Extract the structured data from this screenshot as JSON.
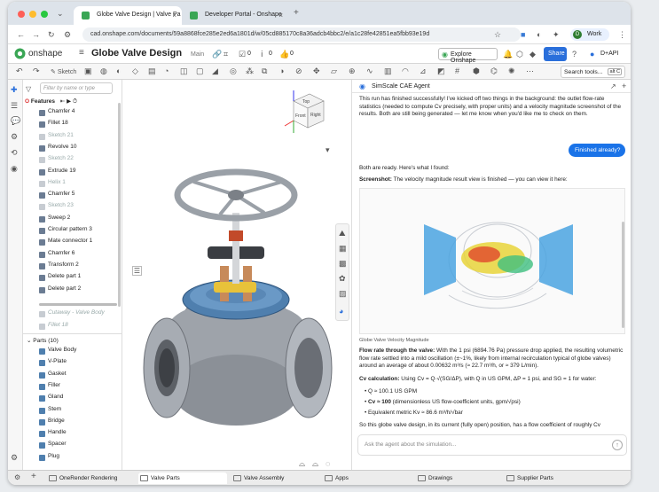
{
  "browser": {
    "tabs": [
      {
        "label": "Globe Valve Design | Valve Pa"
      },
      {
        "label": "Developer Portal - Onshape"
      }
    ],
    "url": "cad.onshape.com/documents/59a8868fce285e2ed6a1801d/w/05cd885170c8a36adcb4bbc2/e/a1c28fe42851ea5fbb93e19d",
    "profile_label": "Work"
  },
  "app": {
    "logo": "onshape",
    "doc_title": "Globe Valve Design",
    "branch": "Main",
    "counts": {
      "a": "0",
      "b": "0",
      "c": "0"
    },
    "explore_label": "Explore Onshape",
    "share_label": "Share",
    "user_label": "D+API",
    "search_label": "Search tools...",
    "search_hint": "alt C",
    "sketch_label": "Sketch"
  },
  "tree": {
    "filter_placeholder": "Filter by name or type",
    "features_label": "Features",
    "items": [
      {
        "label": "Chamfer 4",
        "dim": false
      },
      {
        "label": "Fillet 18",
        "dim": false
      },
      {
        "label": "Sketch 21",
        "dim": true
      },
      {
        "label": "Revolve 10",
        "dim": false
      },
      {
        "label": "Sketch 22",
        "dim": true
      },
      {
        "label": "Extrude 19",
        "dim": false
      },
      {
        "label": "Helix 1",
        "dim": true
      },
      {
        "label": "Chamfer 5",
        "dim": false
      },
      {
        "label": "Sketch 23",
        "dim": true
      },
      {
        "label": "Sweep 2",
        "dim": false
      },
      {
        "label": "Circular pattern 3",
        "dim": false
      },
      {
        "label": "Mate connector 1",
        "dim": false
      },
      {
        "label": "Chamfer 6",
        "dim": false
      },
      {
        "label": "Transform 2",
        "dim": false
      },
      {
        "label": "Delete part 1",
        "dim": false
      },
      {
        "label": "Delete part 2",
        "dim": false
      }
    ],
    "rollback": [
      {
        "label": "Cutaway - Valve Body"
      },
      {
        "label": "Fillet 18"
      }
    ],
    "parts_label": "Parts (10)",
    "parts": [
      "Valve Body",
      "V-Plate",
      "Gasket",
      "Filler",
      "Gland",
      "Stem",
      "Bridge",
      "Handle",
      "Spacer",
      "Plug"
    ]
  },
  "viewcube": {
    "top": "Top",
    "front": "Front",
    "right": "Right"
  },
  "chat": {
    "title": "SimScale CAE Agent",
    "intro": "This run has finished successfully! I've kicked off two things in the background: the outlet flow-rate statistics (needed to compute Cv precisely, with proper units) and a velocity magnitude screenshot of the results. Both are still being generated — let me know when you'd like me to check on them.",
    "user_msg": "Finished already?",
    "ready": "Both are ready. Here's what I found:",
    "shot_label": "Screenshot:",
    "shot_text": " The velocity magnitude result view is finished — you can view it here:",
    "caption": "Globe Valve Velocity Magnitude",
    "flow_label": "Flow rate through the valve:",
    "flow_text": " With the 1 psi (6894.76 Pa) pressure drop applied, the resulting volumetric flow rate settled into a mild oscillation (±~1%, likely from internal recirculation typical of globe valves) around an average of about 0.00632 m³/s (≈ 22.7 m³/h, or ≈ 379 L/min).",
    "cv_label": "Cv calculation:",
    "cv_text": " Using Cv = Q·√(SG/ΔP), with Q in US GPM, ΔP = 1 psi, and SG = 1 for water:",
    "bullet1": "Q ≈ 100.1 US GPM",
    "bullet2_b": "Cv ≈ 100",
    "bullet2": " (dimensionless US flow-coefficient units, gpm/√psi)",
    "bullet3": "Equivalent metric Kv ≈ 86.6 m³/h/√bar",
    "final": "So this globe valve design, in its current (fully open) position, has a flow coefficient of roughly Cv",
    "input_placeholder": "Ask the agent about the simulation..."
  },
  "bottom_tabs": [
    {
      "label": "OneRender Rendering"
    },
    {
      "label": "Valve Parts"
    },
    {
      "label": "Valve Assembly"
    },
    {
      "label": "Apps"
    },
    {
      "label": "Drawings"
    },
    {
      "label": "Supplier Parts"
    }
  ],
  "colors": {
    "accent": "#1a73e8",
    "onshape_green": "#3aa655",
    "share_blue": "#2a6fdb"
  }
}
